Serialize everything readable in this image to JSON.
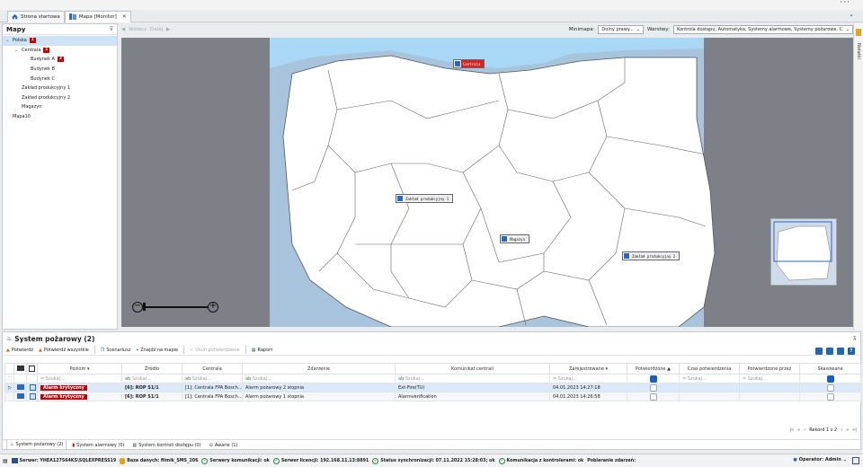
{
  "tabs": [
    {
      "label": "Strona startowa",
      "icon": "home-icon",
      "active": false
    },
    {
      "label": "Mapa [Monitor]",
      "icon": "map-icon",
      "active": true
    }
  ],
  "left_panel": {
    "title": "Mapy",
    "tree": [
      {
        "label": "Polska",
        "badge": "1",
        "level": 0,
        "expanded": true,
        "selected": true
      },
      {
        "label": "Centrala",
        "badge": "1",
        "level": 1,
        "expanded": true,
        "selected": false
      },
      {
        "label": "Budynek A",
        "badge": "2",
        "level": 2,
        "selected": false
      },
      {
        "label": "Budynek B",
        "badge": "",
        "level": 2,
        "selected": false
      },
      {
        "label": "Budynek C",
        "badge": "",
        "level": 2,
        "selected": false
      },
      {
        "label": "Zakład produkcyjny 1",
        "badge": "",
        "level": 1,
        "selected": false
      },
      {
        "label": "Zakład produkcyjny 2",
        "badge": "",
        "level": 1,
        "selected": false
      },
      {
        "label": "Magazyn",
        "badge": "",
        "level": 1,
        "selected": false
      },
      {
        "label": "Mapa10",
        "badge": "",
        "level": 0,
        "selected": false
      }
    ]
  },
  "map_toolbar": {
    "back_label": "Wstecz",
    "forward_label": "Dalej",
    "minimap_label": "Minimapa:",
    "minimap_value": "Dolny prawy...",
    "layers_label": "Warstwy:",
    "layers_value": "Kontrola dostępu, Automatyka, Systemy alarmowe, Systemy pożarowe, C..."
  },
  "map_markers": [
    {
      "label": "Centrala",
      "alarm": true
    },
    {
      "label": "Zakład produkcyjny 1",
      "alarm": false
    },
    {
      "label": "Magazyn",
      "alarm": false
    },
    {
      "label": "Zakład produkcyjny 2",
      "alarm": false
    }
  ],
  "right_sidebar": {
    "label": "Notatki"
  },
  "alarm_panel": {
    "title": "System pożarowy (2)",
    "toolbar": [
      {
        "label": "Potwierdź",
        "icon": "confirm-icon",
        "enabled": true
      },
      {
        "label": "Potwierdź wszystkie",
        "icon": "confirm-all-icon",
        "enabled": true
      },
      {
        "label": "Scenariusz",
        "icon": "scenario-icon",
        "enabled": true
      },
      {
        "label": "Znajdź na mapie",
        "icon": "find-on-map-icon",
        "enabled": true
      },
      {
        "label": "Usuń potwierdzenie",
        "icon": "remove-confirm-icon",
        "enabled": false
      },
      {
        "label": "Raport",
        "icon": "report-icon",
        "enabled": true
      }
    ],
    "columns": [
      "Poziom",
      "Źródło",
      "Centrala",
      "Zdarzenie",
      "Komunikat centrali",
      "Zarejestrowane",
      "Potwierdzone",
      "Czas potwierdzenia",
      "Potwierdzone przez",
      "Skasowane"
    ],
    "filter_placeholder": "Szukaj...",
    "rows": [
      {
        "level": "Alarm krytyczny",
        "source": "[6]: ROP S1/1",
        "panel": "[1]: Centrala FPA Bosch...",
        "event": "Alarm pożarowy 2 stopnia",
        "message": "Ext-Fire(TU)",
        "registered": "04.01.2023 14:27:18",
        "confirmed": false,
        "confirm_time": "",
        "confirmed_by": "",
        "cleared": false
      },
      {
        "level": "Alarm krytyczny",
        "source": "[6]: ROP S1/1",
        "panel": "[1]: Centrala FPA Bosch...",
        "event": "Alarm pożarowy 1 stopnia",
        "message": "Alarmverification",
        "registered": "04.01.2023 14:26:58",
        "confirmed": false,
        "confirm_time": "",
        "confirmed_by": "",
        "cleared": false
      }
    ],
    "pager": {
      "label": "Rekord 1 z 2"
    },
    "bottom_tabs": [
      {
        "label": "System pożarowy (2)",
        "icon": "fire-icon",
        "active": true
      },
      {
        "label": "System alarmowy (0)",
        "icon": "alarm-icon",
        "active": false
      },
      {
        "label": "System kontroli dostępu (0)",
        "icon": "access-icon",
        "active": false
      },
      {
        "label": "Awarie (1)",
        "icon": "failure-icon",
        "active": false
      }
    ]
  },
  "status_bar": {
    "items": [
      {
        "label": "Serwer: YHEA127564KS\\SQLEXPRESS19",
        "icon": "server-icon"
      },
      {
        "label": "Baza danych: filmik_SMS_206",
        "icon": "database-icon"
      },
      {
        "label": "Serwery komunikacji: ok",
        "icon": "ok-icon"
      },
      {
        "label": "Serwer licencji: 192.168.11.13:8891",
        "icon": "ok-icon"
      },
      {
        "label": "Status synchronizacji: 07.11.2022 15:28:03; ok",
        "icon": "ok-icon"
      },
      {
        "label": "Komunikacja z kontrolerami: ok",
        "icon": "ok-icon"
      },
      {
        "label": "Pobieranie zdarzeń:",
        "icon": ""
      }
    ],
    "operator": "Operator: Admin"
  }
}
